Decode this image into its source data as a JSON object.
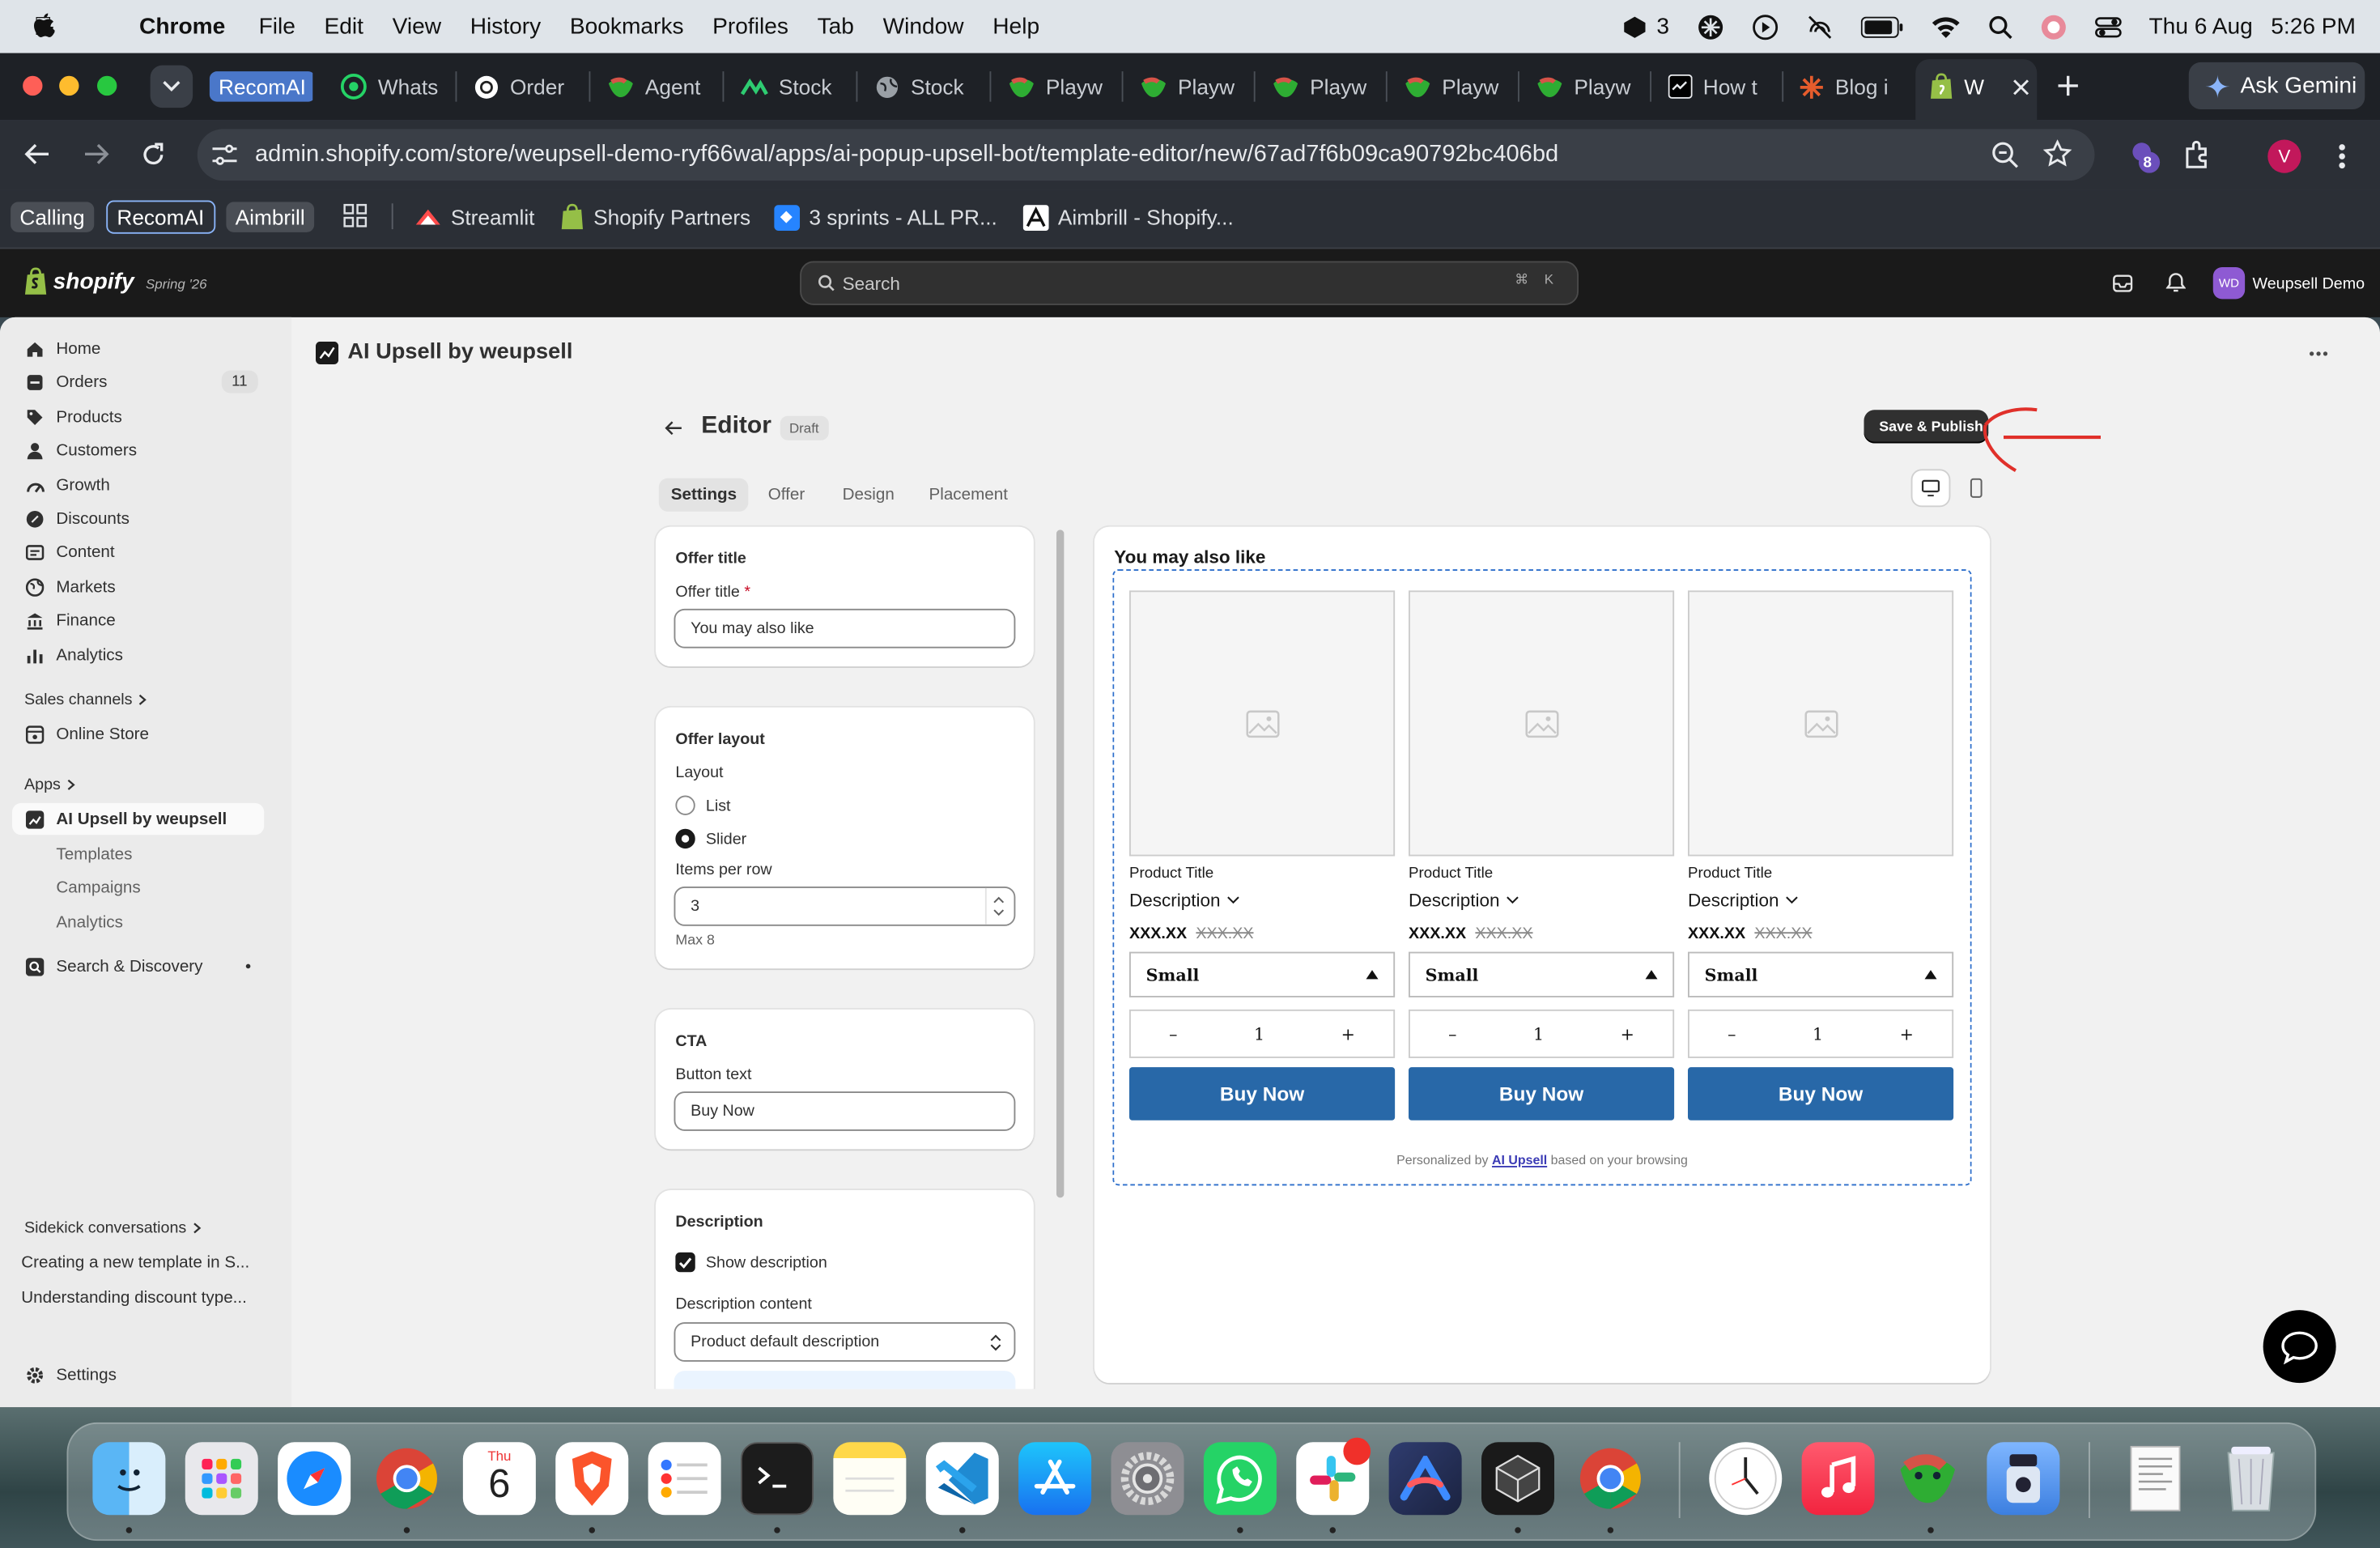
{
  "menubar": {
    "app": "Chrome",
    "items": [
      "File",
      "Edit",
      "View",
      "History",
      "Bookmarks",
      "Profiles",
      "Tab",
      "Window",
      "Help"
    ],
    "badge_count": "3",
    "date": "Thu 6 Aug",
    "time": "5:26 PM"
  },
  "tabs": [
    {
      "label": "RecomAI",
      "color": "#3b82f6"
    },
    {
      "label": "Whats",
      "color": "#25d366"
    },
    {
      "label": "Order",
      "color": "#ffffff"
    },
    {
      "label": "Agent",
      "color": "#95bf47"
    },
    {
      "label": "Stock",
      "color": "#2ecc71"
    },
    {
      "label": "Stock",
      "color": "#9aa0a6"
    },
    {
      "label": "Playw",
      "color": "#95bf47"
    },
    {
      "label": "Playw",
      "color": "#95bf47"
    },
    {
      "label": "Playw",
      "color": "#95bf47"
    },
    {
      "label": "Playw",
      "color": "#95bf47"
    },
    {
      "label": "Playw",
      "color": "#95bf47"
    },
    {
      "label": "How t",
      "color": "#000000"
    },
    {
      "label": "Blog i",
      "color": "#e65c2c"
    },
    {
      "label": "W",
      "color": "#95bf47"
    }
  ],
  "ask_gemini": "Ask Gemini",
  "address": {
    "url": "admin.shopify.com/store/weupsell-demo-ryf66wal/apps/ai-popup-upsell-bot/template-editor/new/67ad7f6b09ca90792bc406bd",
    "ext_badge": "8",
    "profile_initial": "V"
  },
  "bookmarks": {
    "calling": "Calling",
    "recomai": "RecomAI",
    "aimbrill": "Aimbrill",
    "items": [
      "Streamlit",
      "Shopify Partners",
      "3 sprints - ALL PR...",
      "Aimbrill - Shopify..."
    ]
  },
  "shopify": {
    "logo": "shopify",
    "edition": "Spring '26",
    "search_placeholder": "Search",
    "shortcut_cmd": "⌘",
    "shortcut_key": "K",
    "store_initials": "WD",
    "store_name": "Weupsell Demo"
  },
  "sidebar": {
    "items": [
      {
        "label": "Home",
        "icon": "home-icon"
      },
      {
        "label": "Orders",
        "icon": "orders-icon",
        "badge": "11"
      },
      {
        "label": "Products",
        "icon": "products-icon"
      },
      {
        "label": "Customers",
        "icon": "customers-icon"
      },
      {
        "label": "Growth",
        "icon": "growth-icon"
      },
      {
        "label": "Discounts",
        "icon": "discounts-icon"
      },
      {
        "label": "Content",
        "icon": "content-icon"
      },
      {
        "label": "Markets",
        "icon": "markets-icon"
      },
      {
        "label": "Finance",
        "icon": "finance-icon"
      },
      {
        "label": "Analytics",
        "icon": "analytics-icon"
      }
    ],
    "sales_channels": "Sales channels",
    "online_store": "Online Store",
    "apps": "Apps",
    "app_active": "AI Upsell by weupsell",
    "app_subs": [
      "Templates",
      "Campaigns",
      "Analytics"
    ],
    "search_discovery": "Search & Discovery",
    "sidekick": "Sidekick conversations",
    "conversations": [
      "Creating a new template in S...",
      "Understanding discount type..."
    ],
    "settings": "Settings"
  },
  "page": {
    "app_title": "AI Upsell by weupsell",
    "editor_title": "Editor",
    "status": "Draft",
    "save_button": "Save & Publish",
    "tabs": [
      "Settings",
      "Offer",
      "Design",
      "Placement"
    ]
  },
  "form": {
    "offer_title_heading": "Offer title",
    "offer_title_label": "Offer title",
    "required_mark": "*",
    "offer_title_value": "You may also like",
    "layout_heading": "Offer layout",
    "layout_label": "Layout",
    "layout_options": [
      "List",
      "Slider"
    ],
    "layout_selected": "Slider",
    "items_per_row_label": "Items per row",
    "items_per_row_value": "3",
    "items_help": "Max 8",
    "cta_heading": "CTA",
    "button_text_label": "Button text",
    "button_text_value": "Buy Now",
    "description_heading": "Description",
    "show_description": "Show description",
    "show_description_checked": true,
    "description_content_label": "Description content",
    "description_content_value": "Product default description"
  },
  "preview": {
    "heading": "You may also like",
    "products": [
      {
        "title": "Product Title",
        "description": "Description",
        "price": "XXX.XX",
        "compare_price": "XXX.XX",
        "variant": "Small",
        "quantity": "1",
        "buy": "Buy Now"
      },
      {
        "title": "Product Title",
        "description": "Description",
        "price": "XXX.XX",
        "compare_price": "XXX.XX",
        "variant": "Small",
        "quantity": "1",
        "buy": "Buy Now"
      },
      {
        "title": "Product Title",
        "description": "Description",
        "price": "XXX.XX",
        "compare_price": "XXX.XX",
        "variant": "Small",
        "quantity": "1",
        "buy": "Buy Now"
      }
    ],
    "footer_prefix": "Personalized by",
    "footer_link": "AI Upsell",
    "footer_suffix": "based on your browsing",
    "qty_minus": "–",
    "qty_plus": "+"
  },
  "dock": {
    "calendar_month": "Thu",
    "calendar_day": "6",
    "apps": [
      "finder-icon",
      "launchpad-icon",
      "safari-icon",
      "chrome-icon",
      "calendar-icon",
      "brave-icon",
      "reminders-icon",
      "terminal-icon",
      "notes-icon",
      "vscode-icon",
      "app-store-icon",
      "system-settings-icon",
      "whatsapp-icon",
      "slack-icon",
      "arc-icon",
      "cursor-icon",
      "chrome-icon",
      "clock-icon",
      "music-icon",
      "playwright-icon",
      "disk-utility-icon",
      "document-icon",
      "trash-icon"
    ]
  },
  "colors": {
    "accent": "#2868a8",
    "annotation_arrow": "#e0302a",
    "preview_border": "#2c6ecb",
    "shopify_bar": "#1a1a1a"
  }
}
